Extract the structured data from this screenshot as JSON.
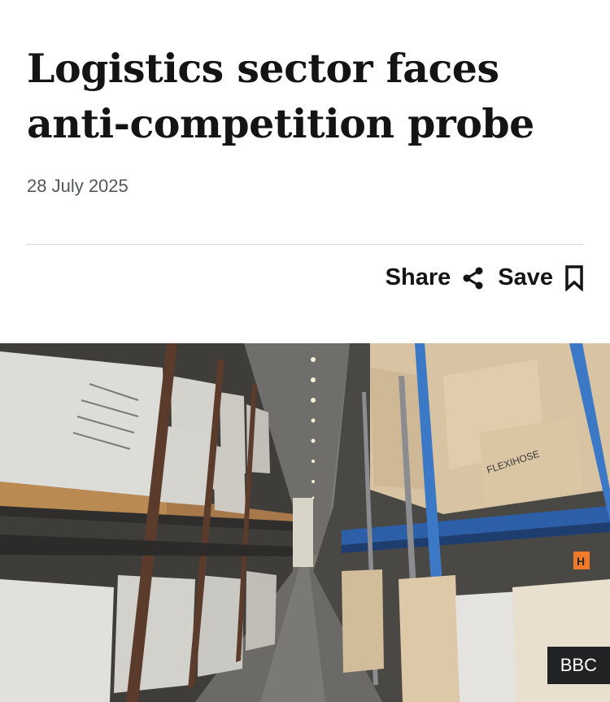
{
  "article": {
    "headline": "Logistics sector faces anti-competition probe",
    "date": "28 July 2025"
  },
  "actions": {
    "share_label": "Share",
    "save_label": "Save",
    "share_icon": "share-icon",
    "save_icon": "bookmark-icon"
  },
  "image": {
    "credit": "BBC",
    "box_label": "FLEXIHOSE"
  }
}
